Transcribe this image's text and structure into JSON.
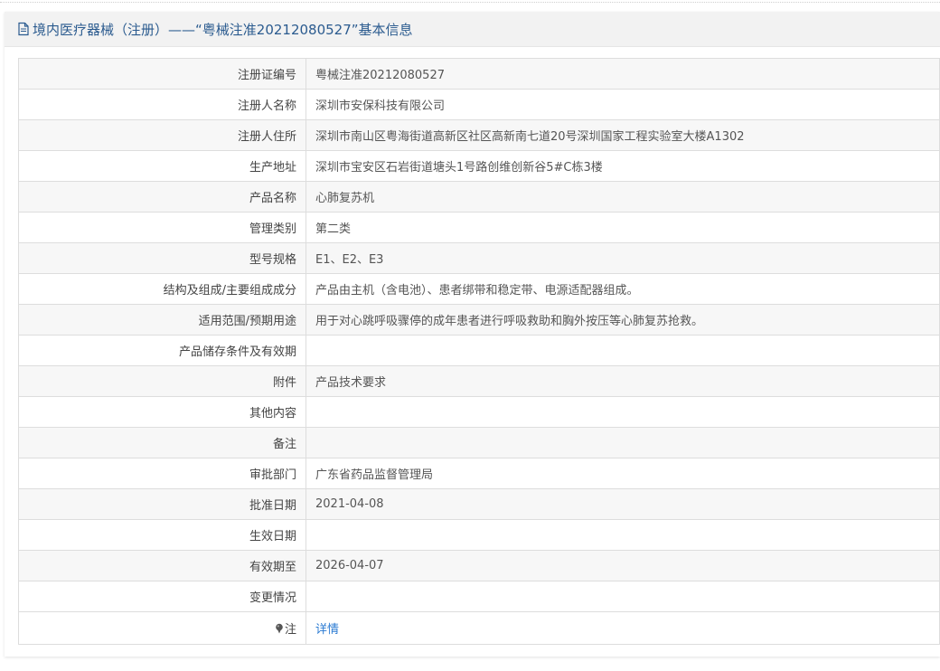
{
  "header": {
    "title": "境内医疗器械（注册）——“粤械注准20212080527”基本信息",
    "icon": "document-icon"
  },
  "rows": [
    {
      "label": "注册证编号",
      "value": "粤械注准20212080527"
    },
    {
      "label": "注册人名称",
      "value": "深圳市安保科技有限公司"
    },
    {
      "label": "注册人住所",
      "value": "深圳市南山区粤海街道高新区社区高新南七道20号深圳国家工程实验室大楼A1302"
    },
    {
      "label": "生产地址",
      "value": "深圳市宝安区石岩街道塘头1号路创维创新谷5#C栋3楼"
    },
    {
      "label": "产品名称",
      "value": "心肺复苏机"
    },
    {
      "label": "管理类别",
      "value": "第二类"
    },
    {
      "label": "型号规格",
      "value": "E1、E2、E3"
    },
    {
      "label": "结构及组成/主要组成成分",
      "value": "产品由主机（含电池）、患者绑带和稳定带、电源适配器组成。"
    },
    {
      "label": "适用范围/预期用途",
      "value": "用于对心跳呼吸骤停的成年患者进行呼吸救助和胸外按压等心肺复苏抢救。"
    },
    {
      "label": "产品储存条件及有效期",
      "value": ""
    },
    {
      "label": "附件",
      "value": "产品技术要求"
    },
    {
      "label": "其他内容",
      "value": ""
    },
    {
      "label": "备注",
      "value": ""
    },
    {
      "label": "审批部门",
      "value": "广东省药品监督管理局"
    },
    {
      "label": "批准日期",
      "value": "2021-04-08"
    },
    {
      "label": "生效日期",
      "value": ""
    },
    {
      "label": "有效期至",
      "value": "2026-04-07"
    },
    {
      "label": "变更情况",
      "value": ""
    }
  ],
  "note": {
    "label": "注",
    "icon": "pin-icon",
    "link_text": "详情",
    "link_color": "#2a7ad2"
  },
  "colors": {
    "header_text": "#2b5b8f",
    "header_bg": "#f2f2f2",
    "row_alt_bg": "#f7f7f7",
    "border": "#dddddd"
  }
}
